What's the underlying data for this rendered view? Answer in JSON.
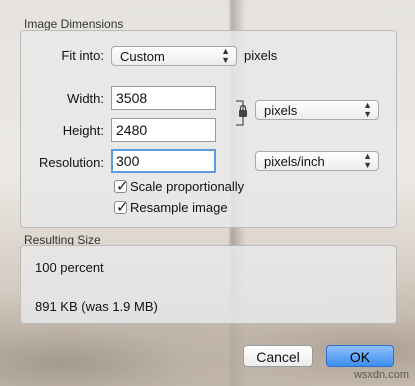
{
  "image_dimensions": {
    "title": "Image Dimensions",
    "fit_into": {
      "label": "Fit into:",
      "value": "Custom",
      "unit": "pixels"
    },
    "width": {
      "label": "Width:",
      "value": "3508"
    },
    "height": {
      "label": "Height:",
      "value": "2480"
    },
    "dimension_unit": {
      "value": "pixels"
    },
    "resolution": {
      "label": "Resolution:",
      "value": "300",
      "unit": "pixels/inch"
    },
    "scale_proportionally": {
      "label": "Scale proportionally",
      "checked": true
    },
    "resample_image": {
      "label": "Resample image",
      "checked": true
    }
  },
  "resulting_size": {
    "title": "Resulting Size",
    "percent": "100 percent",
    "file_size": "891 KB (was 1.9 MB)"
  },
  "buttons": {
    "cancel": "Cancel",
    "ok": "OK"
  },
  "watermark": "wsxdn.com",
  "colors": {
    "accent": "#3d8df0",
    "focus_ring": "#5d9be0"
  }
}
